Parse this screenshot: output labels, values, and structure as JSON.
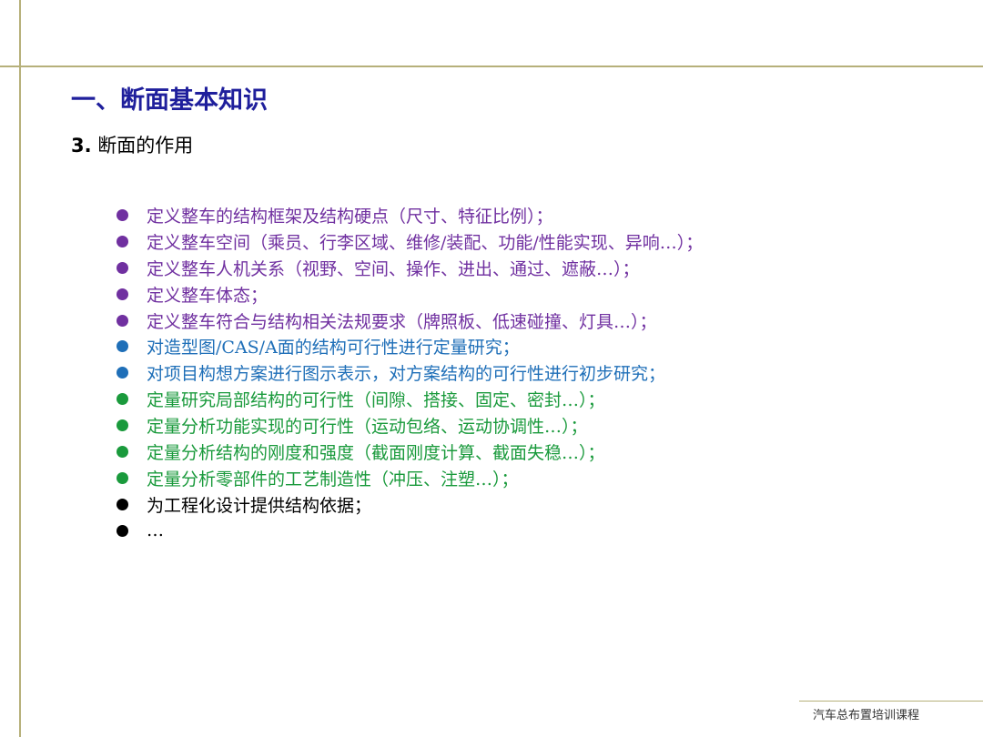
{
  "slide": {
    "title": "一、断面基本知识",
    "subtitle_num": "3.",
    "subtitle_text": " 断面的作用",
    "footer": "汽车总布置培训课程"
  },
  "colors": {
    "purple": "#7030a0",
    "blue": "#1f6fb8",
    "green": "#1a9a3c",
    "black": "#000000"
  },
  "bullets": [
    {
      "text": "定义整车的结构框架及结构硬点（尺寸、特征比例）；",
      "color": "#7030a0"
    },
    {
      "text": "定义整车空间（乘员、行李区域、维修/装配、功能/性能实现、异响…）；",
      "color": "#7030a0"
    },
    {
      "text": "定义整车人机关系（视野、空间、操作、进出、通过、遮蔽…）；",
      "color": "#7030a0"
    },
    {
      "text": "定义整车体态；",
      "color": "#7030a0"
    },
    {
      "text": "定义整车符合与结构相关法规要求（牌照板、低速碰撞、灯具…）；",
      "color": "#7030a0"
    },
    {
      "text": "对造型图/CAS/A面的结构可行性进行定量研究；",
      "color": "#1f6fb8"
    },
    {
      "text": "对项目构想方案进行图示表示，对方案结构的可行性进行初步研究；",
      "color": "#1f6fb8"
    },
    {
      "text": "定量研究局部结构的可行性（间隙、搭接、固定、密封…）；",
      "color": "#1a9a3c"
    },
    {
      "text": "定量分析功能实现的可行性（运动包络、运动协调性…）；",
      "color": "#1a9a3c"
    },
    {
      "text": "定量分析结构的刚度和强度（截面刚度计算、截面失稳…）；",
      "color": "#1a9a3c"
    },
    {
      "text": "定量分析零部件的工艺制造性（冲压、注塑…）；",
      "color": "#1a9a3c"
    },
    {
      "text": "为工程化设计提供结构依据；",
      "color": "#000000"
    },
    {
      "text": "…",
      "color": "#000000"
    }
  ]
}
